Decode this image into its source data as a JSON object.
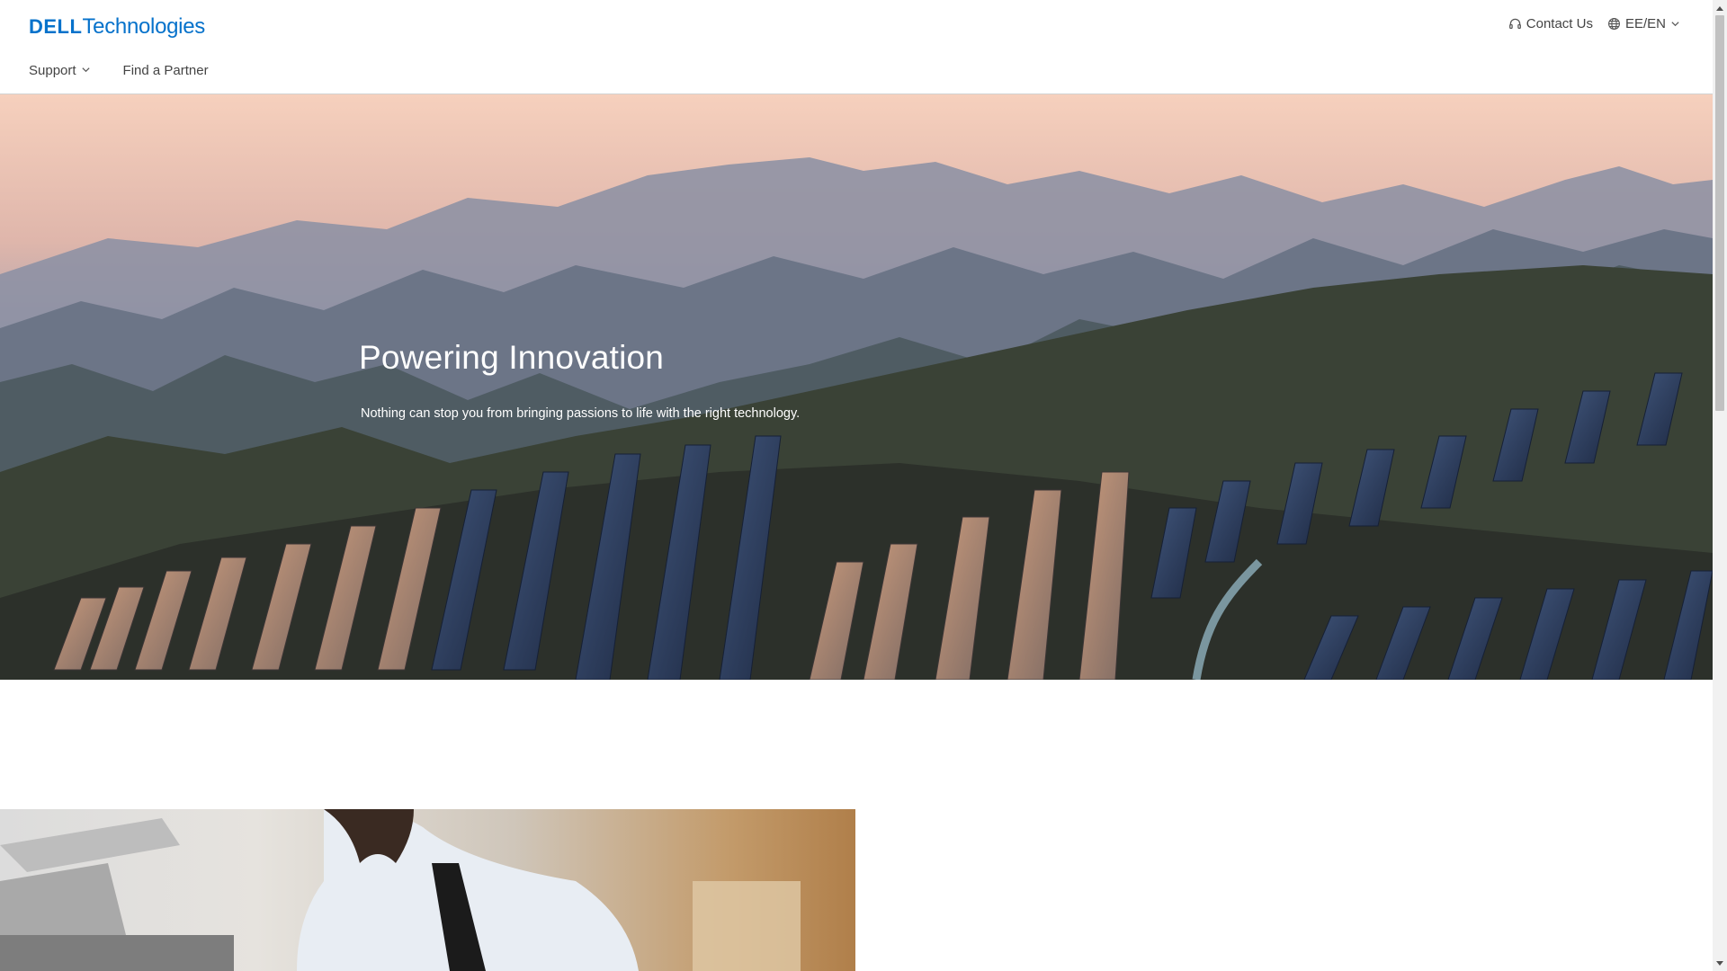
{
  "header": {
    "logo": {
      "brand": "DELL",
      "suffix": "Technologies"
    },
    "utility": {
      "contact_label": "Contact Us",
      "locale_label": "EE/EN"
    },
    "nav": {
      "support_label": "Support",
      "partner_label": "Find a Partner"
    }
  },
  "hero": {
    "title": "Powering Innovation",
    "subtitle": "Nothing can stop you from bringing passions to life with the right technology."
  },
  "colors": {
    "brand_blue": "#0672cb",
    "text_gray": "#444444"
  }
}
